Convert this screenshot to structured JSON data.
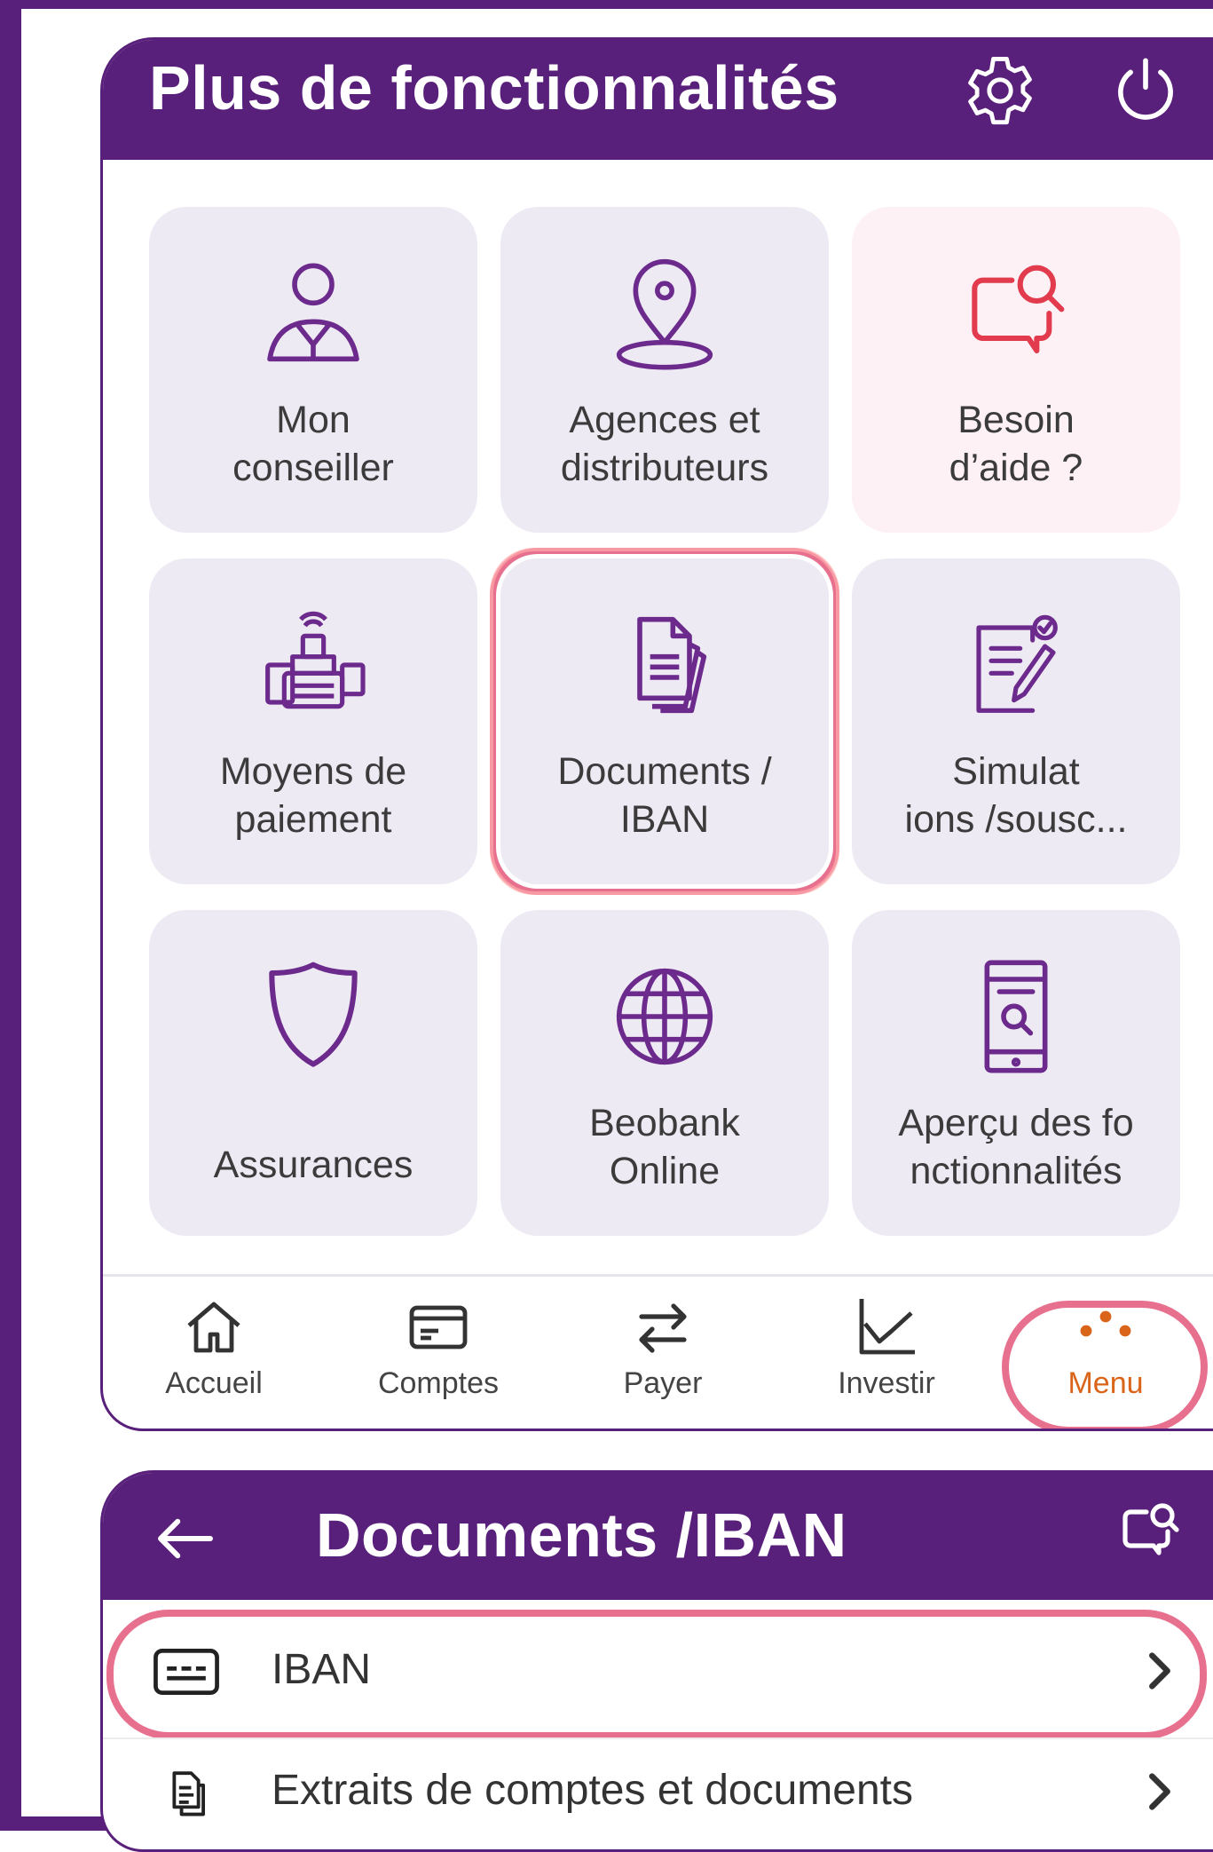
{
  "screen1": {
    "title": "Plus de fonctionnalités",
    "header_icons": [
      "gear-icon",
      "power-icon"
    ],
    "tiles": [
      {
        "label": "Mon\nconseiller",
        "icon": "advisor-icon"
      },
      {
        "label": "Agences et\ndistributeurs",
        "icon": "location-pin-icon"
      },
      {
        "label": "Besoin\nd’aide ?",
        "icon": "help-chat-search-icon"
      },
      {
        "label": "Moyens de\npaiement",
        "icon": "payment-devices-icon"
      },
      {
        "label": "Documents /\nIBAN",
        "icon": "documents-icon"
      },
      {
        "label": "Simulat\nions  /sousc...",
        "icon": "simulation-edit-icon"
      },
      {
        "label": "Assurances",
        "icon": "shield-icon"
      },
      {
        "label": "Beobank\nOnline",
        "icon": "globe-icon"
      },
      {
        "label": "Aperçu des fo\nnctionnalités",
        "icon": "phone-search-icon"
      }
    ],
    "bottom_nav": [
      {
        "label": "Accueil",
        "icon": "home-icon"
      },
      {
        "label": "Comptes",
        "icon": "card-icon"
      },
      {
        "label": "Payer",
        "icon": "transfer-arrows-icon"
      },
      {
        "label": "Investir",
        "icon": "chart-line-icon"
      },
      {
        "label": "Menu",
        "icon": "dots-icon",
        "active": true
      }
    ],
    "colors": {
      "brand": "#58207a",
      "highlight": "#e8708f",
      "active": "#d9641a",
      "tile_bg": "#eeeaf4",
      "help_accent": "#e23b4e"
    }
  },
  "screen2": {
    "title": "Documents /IBAN",
    "rows": [
      {
        "label": "IBAN",
        "icon": "iban-card-icon"
      },
      {
        "label": "Extraits de comptes et documents",
        "icon": "statement-icon"
      }
    ]
  }
}
